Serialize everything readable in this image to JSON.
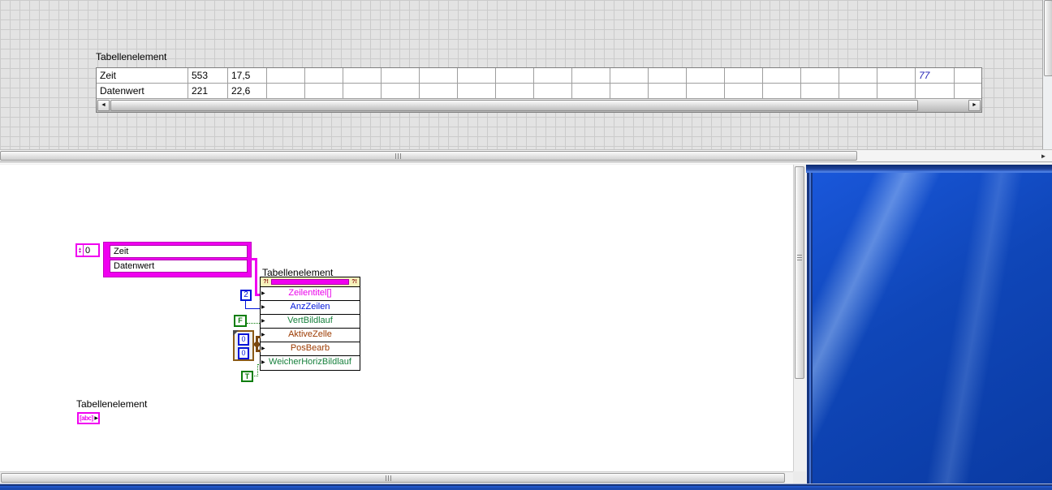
{
  "front_panel": {
    "table_label": "Tabellenelement",
    "table": {
      "rows": [
        {
          "cells": [
            "Zeit",
            "553",
            "17,5"
          ]
        },
        {
          "cells": [
            "Datenwert",
            "221",
            "22,6"
          ]
        }
      ],
      "far_value": "77",
      "empty_cols_before_far": 17
    }
  },
  "block_diagram": {
    "array_constant": {
      "index": "0",
      "items": [
        "Zeit",
        "Datenwert"
      ]
    },
    "property_node": {
      "label": "Tabellenelement",
      "ref_marker": "?!",
      "properties": [
        {
          "name": "Zeilentitel[]",
          "color": "#ea00ea"
        },
        {
          "name": "AnzZeilen",
          "color": "#0016dc"
        },
        {
          "name": "VertBildlauf",
          "color": "#16803c"
        },
        {
          "name": "AktiveZelle",
          "color": "#9c3a00"
        },
        {
          "name": "PosBearb",
          "color": "#9c3a00"
        },
        {
          "name": "WeicherHorizBildlauf",
          "color": "#16803c"
        }
      ]
    },
    "constants": {
      "num_rows": "2",
      "vert_scroll": "F",
      "cluster_values": [
        "0",
        "0"
      ],
      "smooth_horiz_scroll": "T"
    },
    "terminal": {
      "label": "Tabellenelement",
      "glyph": "[abc]"
    }
  },
  "scrollbar_arrows": {
    "left": "◄",
    "right": "►",
    "up_small": "▲",
    "down_small": "▼"
  },
  "colors": {
    "labview_magenta": "#f000f0",
    "numeric_blue": "#0014d8",
    "boolean_green": "#0a7d0a",
    "cluster_brown": "#7a4810",
    "desktop_blue": "#0f46b8",
    "panel_grid_grey": "#e3e3e3"
  }
}
